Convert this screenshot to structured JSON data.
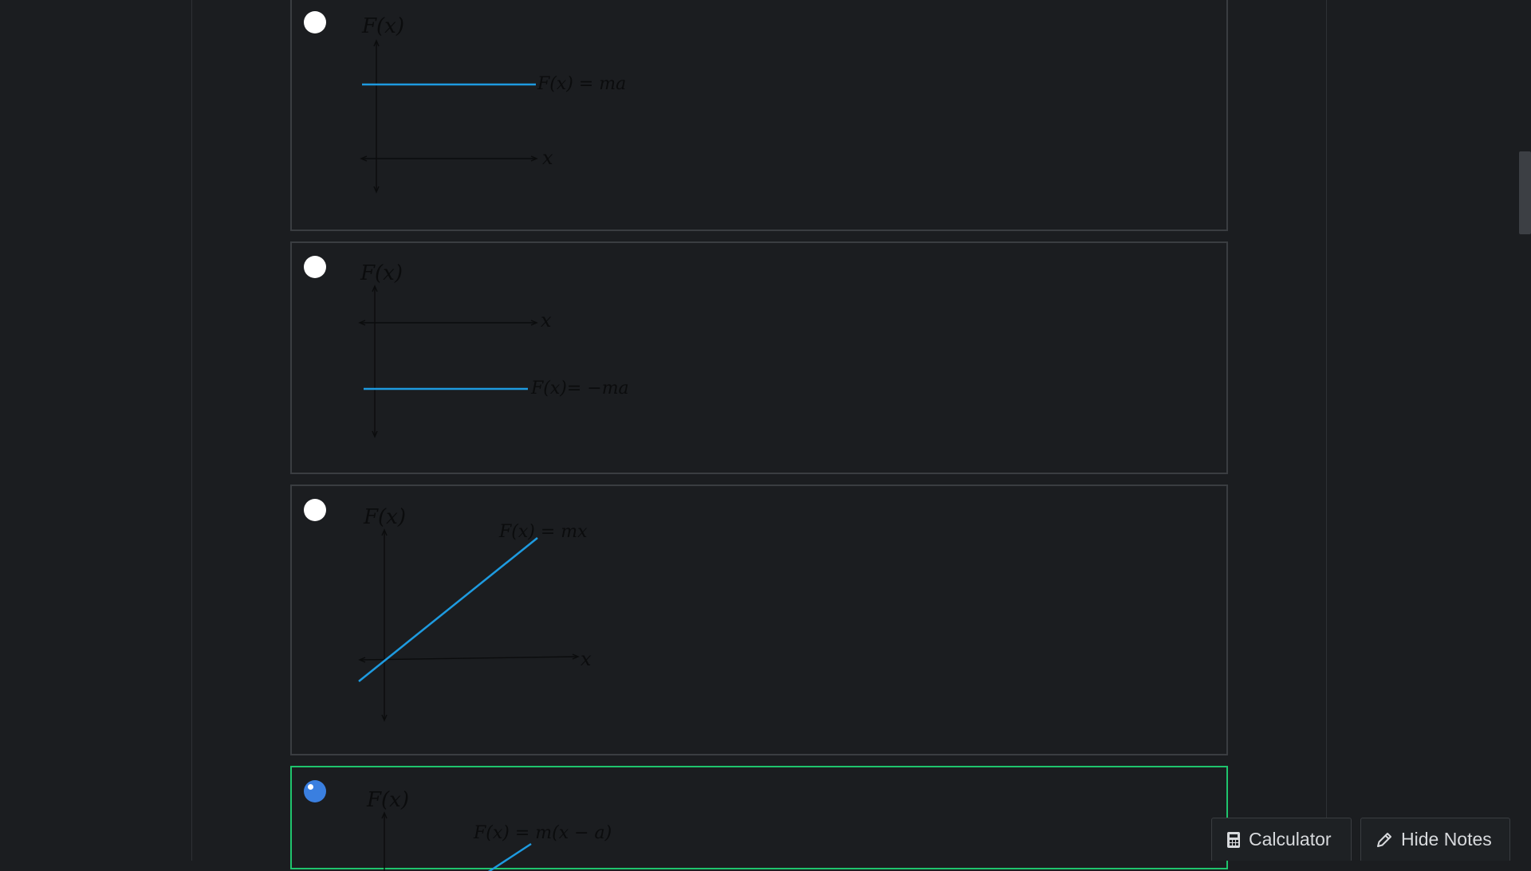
{
  "options": [
    {
      "selected": false,
      "graph": {
        "fx_label": "F(x)",
        "x_label": "x",
        "line_label": "F(x) = ma"
      }
    },
    {
      "selected": false,
      "graph": {
        "fx_label": "F(x)",
        "x_label": "x",
        "line_label": "F(x)= −ma"
      }
    },
    {
      "selected": false,
      "graph": {
        "fx_label": "F(x)",
        "x_label": "x",
        "line_label": "F(x) = mx"
      }
    },
    {
      "selected": true,
      "graph": {
        "fx_label": "F(x)",
        "line_label": "F(x) = m(x − a)"
      }
    }
  ],
  "toolbar": {
    "calculator_label": "Calculator",
    "hide_notes_label": "Hide Notes"
  },
  "colors": {
    "plot_line": "#1e9be0",
    "selected_border": "#1fc46d",
    "radio_checked": "#3a7fe0",
    "background": "#1b1d20"
  },
  "icons": [
    "calculator-icon",
    "pencil-icon"
  ]
}
